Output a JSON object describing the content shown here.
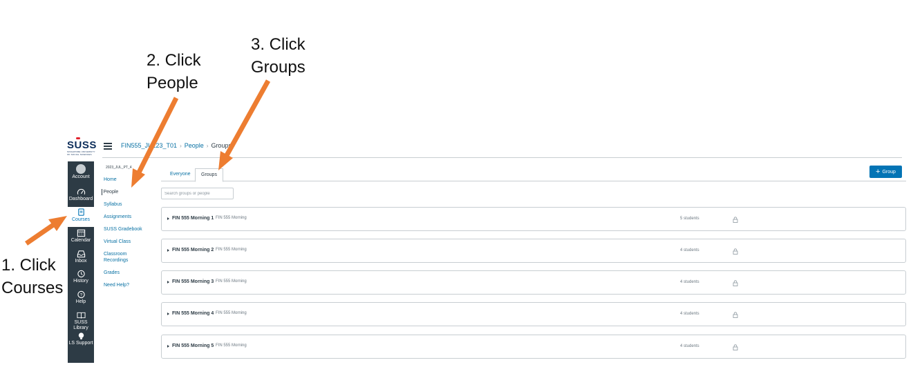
{
  "annotations": {
    "step1_line1": "1. Click",
    "step1_line2": "Courses",
    "step2_line1": "2. Click",
    "step2_line2": "People",
    "step3_line1": "3. Click",
    "step3_line2": "Groups",
    "arrow_color": "#ed7d31"
  },
  "brand": {
    "logo_text_pre": "S",
    "logo_text_u": "U",
    "logo_text_post": "SS",
    "logo_sub1": "SINGAPORE UNIVERSITY",
    "logo_sub2": "OF SOCIAL SCIENCES",
    "nav_bg": "#2d3b45",
    "link_color": "#0770a3",
    "button_color": "#0374b5"
  },
  "global_nav": {
    "account": "Account",
    "dashboard": "Dashboard",
    "courses": "Courses",
    "calendar": "Calendar",
    "inbox": "Inbox",
    "history": "History",
    "help": "Help",
    "library": "SUSS Library",
    "ls_support": "LS Support"
  },
  "breadcrumb": {
    "course": "FIN555_JUL23_T01",
    "people": "People",
    "current": "Groups",
    "separator": "›"
  },
  "course_nav": {
    "term": "2023_JUL_PT_4",
    "items": [
      "Home",
      "People",
      "Syllabus",
      "Assignments",
      "SUSS Gradebook",
      "Virtual Class",
      "Classroom Recordings",
      "Grades",
      "Need Help?"
    ]
  },
  "tabs": {
    "everyone": "Everyone",
    "groups": "Groups"
  },
  "add_group_button": {
    "icon": "+",
    "label": "Group"
  },
  "search": {
    "placeholder": "Search groups or people",
    "value": ""
  },
  "groups": [
    {
      "name": "FIN 555 Morning 1",
      "category": "FIN 555 Morning",
      "count": "5 students"
    },
    {
      "name": "FIN 555 Morning 2",
      "category": "FIN 555 Morning",
      "count": "4 students"
    },
    {
      "name": "FIN 555 Morning 3",
      "category": "FIN 555 Morning",
      "count": "4 students"
    },
    {
      "name": "FIN 555 Morning 4",
      "category": "FIN 555 Morning",
      "count": "4 students"
    },
    {
      "name": "FIN 555 Morning 5",
      "category": "FIN 555 Morning",
      "count": "4 students"
    }
  ]
}
